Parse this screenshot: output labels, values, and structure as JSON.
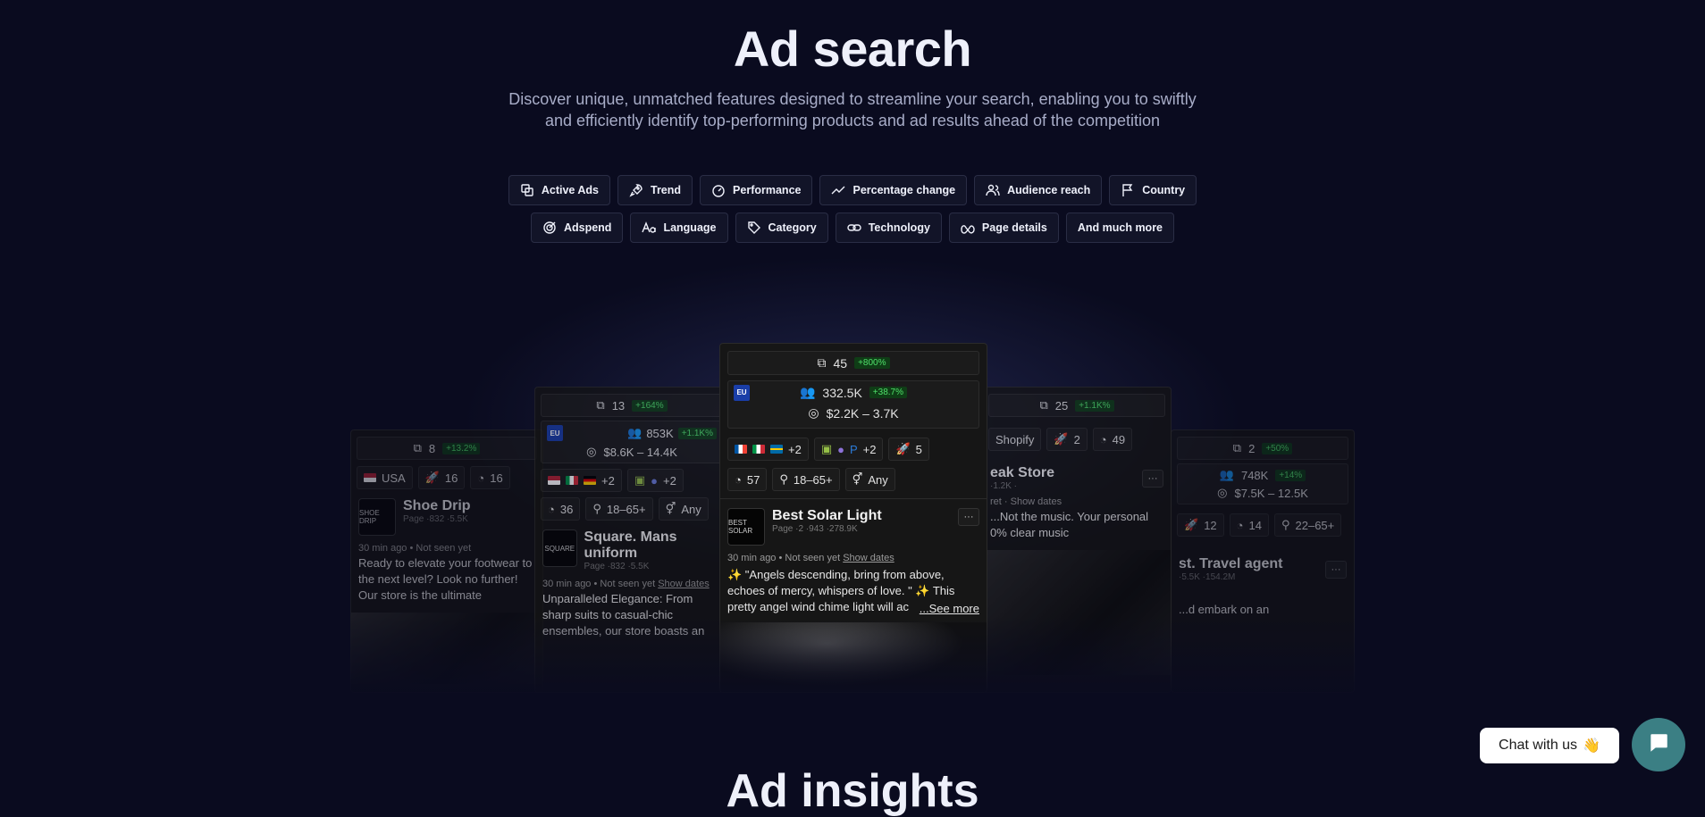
{
  "hero": {
    "title": "Ad search",
    "subtitle_line1": "Discover unique, unmatched features designed to streamline your search, enabling you to swiftly",
    "subtitle_line2": "and efficiently identify top-performing products and ad results ahead of the competition"
  },
  "features_row1": [
    {
      "label": "Active Ads",
      "icon": "copy-icon"
    },
    {
      "label": "Trend",
      "icon": "rocket-icon"
    },
    {
      "label": "Performance",
      "icon": "gauge-icon"
    },
    {
      "label": "Percentage change",
      "icon": "trend-line-icon"
    },
    {
      "label": "Audience reach",
      "icon": "users-icon"
    },
    {
      "label": "Country",
      "icon": "flag-icon"
    }
  ],
  "features_row2": [
    {
      "label": "Adspend",
      "icon": "target-icon"
    },
    {
      "label": "Language",
      "icon": "text-aa-icon"
    },
    {
      "label": "Category",
      "icon": "tag-icon"
    },
    {
      "label": "Technology",
      "icon": "link-icon"
    },
    {
      "label": "Page details",
      "icon": "meta-icon"
    },
    {
      "label": "And much more",
      "icon": ""
    }
  ],
  "main_card": {
    "active_ads": "45",
    "active_ads_change": "+800%",
    "region": "EU",
    "reach": "332.5K",
    "reach_change": "+38.7%",
    "adspend": "$2.2K – 3.7K",
    "countries_more": "+2",
    "tech_more": "+2",
    "trend": "5",
    "performance": "57",
    "age": "18–65+",
    "gender": "Any",
    "page_name": "Best Solar Light",
    "page_meta": "Page ·2 ·943 ·278.9K",
    "logo_text": "BEST SOLAR",
    "time": "30 min ago • Not seen yet",
    "show_dates": "Show dates",
    "ad_text": "✨ \"Angels descending, bring from above, echoes of mercy, whispers of love. \" ✨ This pretty angel wind chime light will ac",
    "see_more": "...See more",
    "more_menu": "···"
  },
  "card_shoe": {
    "active_ads": "8",
    "active_ads_change": "+13.2%",
    "country": "USA",
    "trend": "16",
    "performance": "16",
    "page_name": "Shoe Drip",
    "page_meta": "Page ·832 ·5.5K",
    "logo_text": "SHOE DRIP",
    "time": "30 min ago • Not seen yet",
    "ad_text": "Ready to elevate your footwear to the next level? Look no further! Our store is the ultimate destination for all"
  },
  "card_square": {
    "active_ads": "13",
    "active_ads_change": "+164%",
    "region": "EU",
    "reach": "853K",
    "reach_change": "+1.1K%",
    "adspend": "$8.6K – 14.4K",
    "countries_more": "+2",
    "tech_more": "+2",
    "performance": "36",
    "age": "18–65+",
    "gender": "Any",
    "page_name": "Square. Mans uniform",
    "page_meta": "Page ·832 ·5.5K",
    "logo_text": "SQUARE",
    "time": "30 min ago • Not seen yet",
    "show_dates": "Show dates",
    "ad_text": "Unparalleled Elegance: From sharp suits to casual-chic ensembles, our store boasts an array of clothing that caters"
  },
  "card_freak": {
    "active_ads": "25",
    "active_ads_change": "+1.1K%",
    "tech": "Shopify",
    "trend": "2",
    "performance": "49",
    "page_name": "eak Store",
    "page_meta": "·1.2K ·",
    "time": "ret · Show dates",
    "ad_text": "...Not the music. Your personal 0% clear music",
    "more_menu": "···"
  },
  "card_travel": {
    "active_ads": "2",
    "active_ads_change": "+50%",
    "reach": "748K",
    "reach_change": "+14%",
    "adspend": "$7.5K – 12.5K",
    "trend": "12",
    "performance": "14",
    "age": "22–65+",
    "page_name": "st. Travel agent",
    "page_meta": "·5.5K ·154.2M",
    "ad_text": "...d embark on an",
    "more_menu": "···"
  },
  "next_section": {
    "title": "Ad insights"
  },
  "chat": {
    "label": "Chat with us",
    "emoji": "👋"
  },
  "colors": {
    "background": "#0a0b1f",
    "badge_green": "#4fe06a",
    "chat_button": "#3b7f84",
    "eu_blue": "#1a3ea8"
  }
}
